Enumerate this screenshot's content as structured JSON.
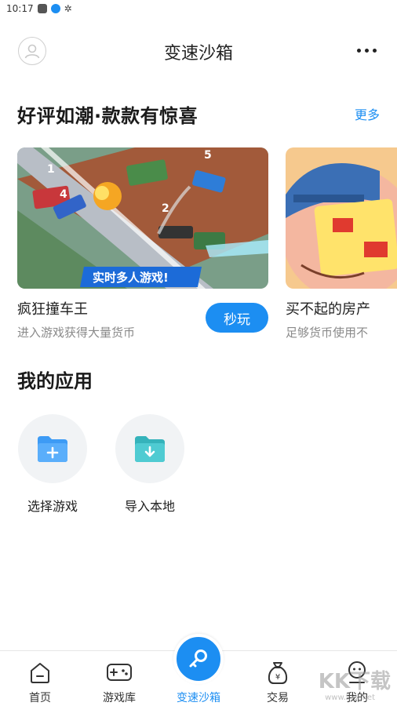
{
  "status": {
    "time": "10:17"
  },
  "header": {
    "title": "变速沙箱"
  },
  "section": {
    "title": "好评如潮·款款有惊喜",
    "more_label": "更多"
  },
  "games": [
    {
      "name": "疯狂撞车王",
      "desc": "进入游戏获得大量货币",
      "banner_text": "实时多人游戏!",
      "button": "秒玩"
    },
    {
      "name": "买不起的房产",
      "desc": "足够货币使用不"
    }
  ],
  "my_apps": {
    "title": "我的应用",
    "items": [
      {
        "label": "选择游戏",
        "icon": "folder-plus-icon"
      },
      {
        "label": "导入本地",
        "icon": "folder-download-icon"
      }
    ]
  },
  "nav": {
    "items": [
      {
        "label": "首页",
        "icon": "home-icon"
      },
      {
        "label": "游戏库",
        "icon": "gamepad-icon"
      },
      {
        "label": "变速沙箱",
        "icon": "key-icon",
        "active": true
      },
      {
        "label": "交易",
        "icon": "money-bag-icon"
      },
      {
        "label": "我的",
        "icon": "profile-icon"
      }
    ]
  },
  "watermark": {
    "text": "KK下载",
    "url": "www.kkx.net"
  },
  "colors": {
    "accent": "#1c8ef2",
    "folder_blue": "#3d9bf5",
    "folder_teal": "#3ec1c9"
  }
}
